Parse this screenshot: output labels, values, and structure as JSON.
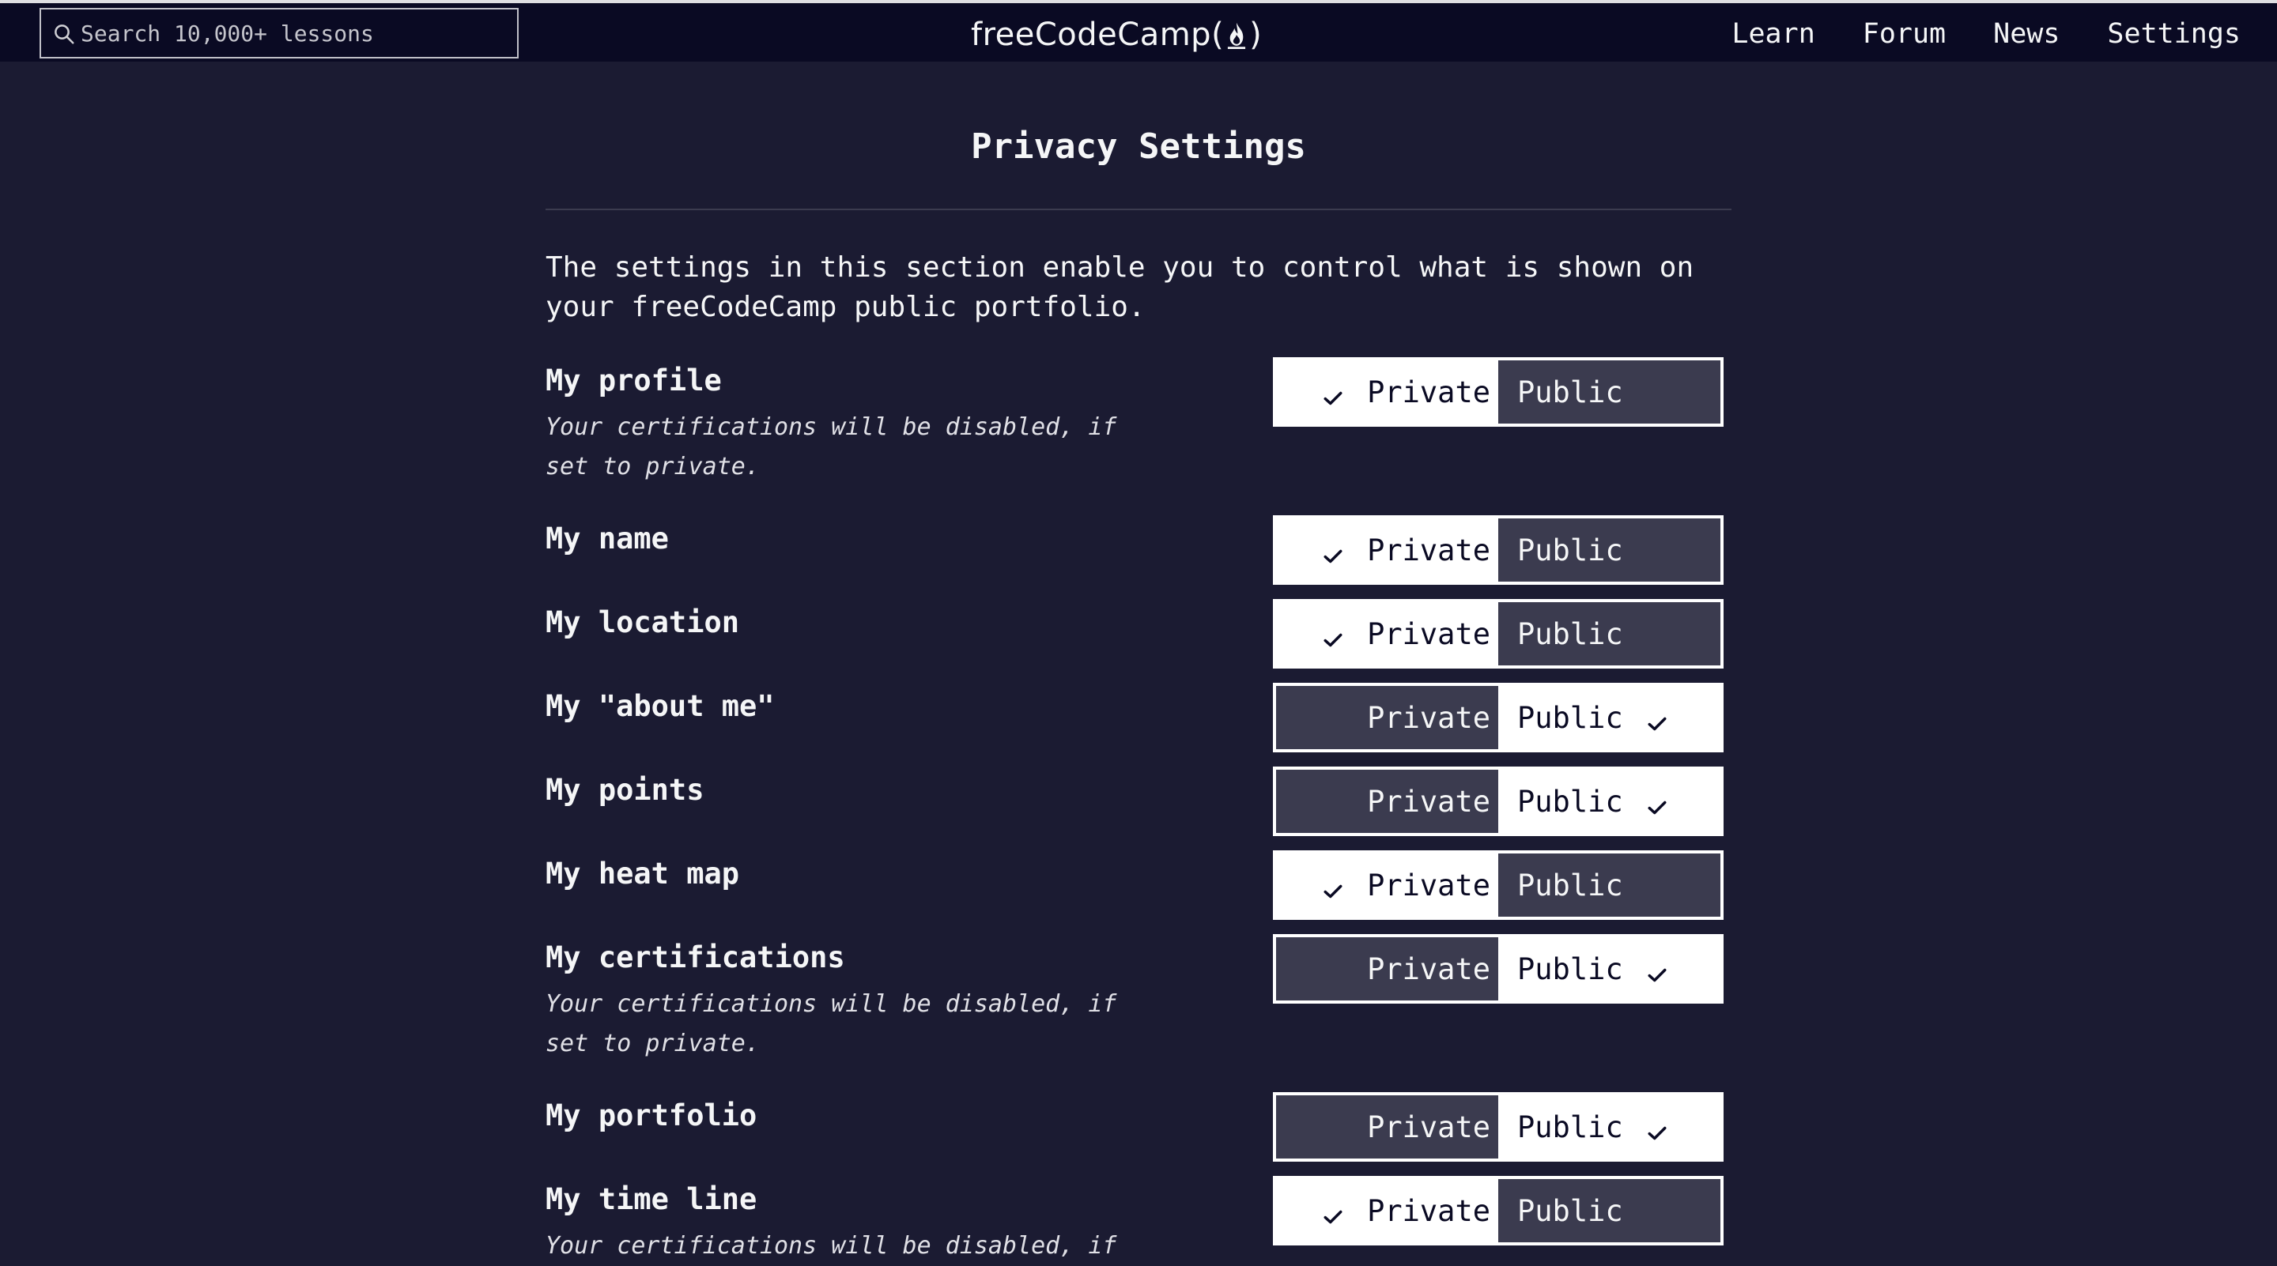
{
  "nav": {
    "search_placeholder": "Search 10,000+ lessons",
    "logo_text_before": "freeCodeCamp(",
    "logo_text_after": ")",
    "links": [
      {
        "label": "Learn"
      },
      {
        "label": "Forum"
      },
      {
        "label": "News"
      },
      {
        "label": "Settings"
      }
    ]
  },
  "page": {
    "title": "Privacy Settings",
    "intro": "The settings in this section enable you to control what is shown on your freeCodeCamp public portfolio."
  },
  "toggle_labels": {
    "private": "Private",
    "public": "Public"
  },
  "settings": [
    {
      "label": "My profile",
      "note": "Your certifications will be disabled, if set to private.",
      "selected": "private"
    },
    {
      "label": "My name",
      "note": "",
      "selected": "private"
    },
    {
      "label": "My location",
      "note": "",
      "selected": "private"
    },
    {
      "label": "My \"about me\"",
      "note": "",
      "selected": "public"
    },
    {
      "label": "My points",
      "note": "",
      "selected": "public"
    },
    {
      "label": "My heat map",
      "note": "",
      "selected": "private"
    },
    {
      "label": "My certifications",
      "note": "Your certifications will be disabled, if set to private.",
      "selected": "public"
    },
    {
      "label": "My portfolio",
      "note": "",
      "selected": "public"
    },
    {
      "label": "My time line",
      "note": "Your certifications will be disabled, if",
      "selected": "private"
    }
  ],
  "colors": {
    "background": "#1b1b32",
    "navbar": "#0a0a23",
    "toggle_selected": "#ffffff",
    "toggle_unselected": "#3b3b4f"
  }
}
